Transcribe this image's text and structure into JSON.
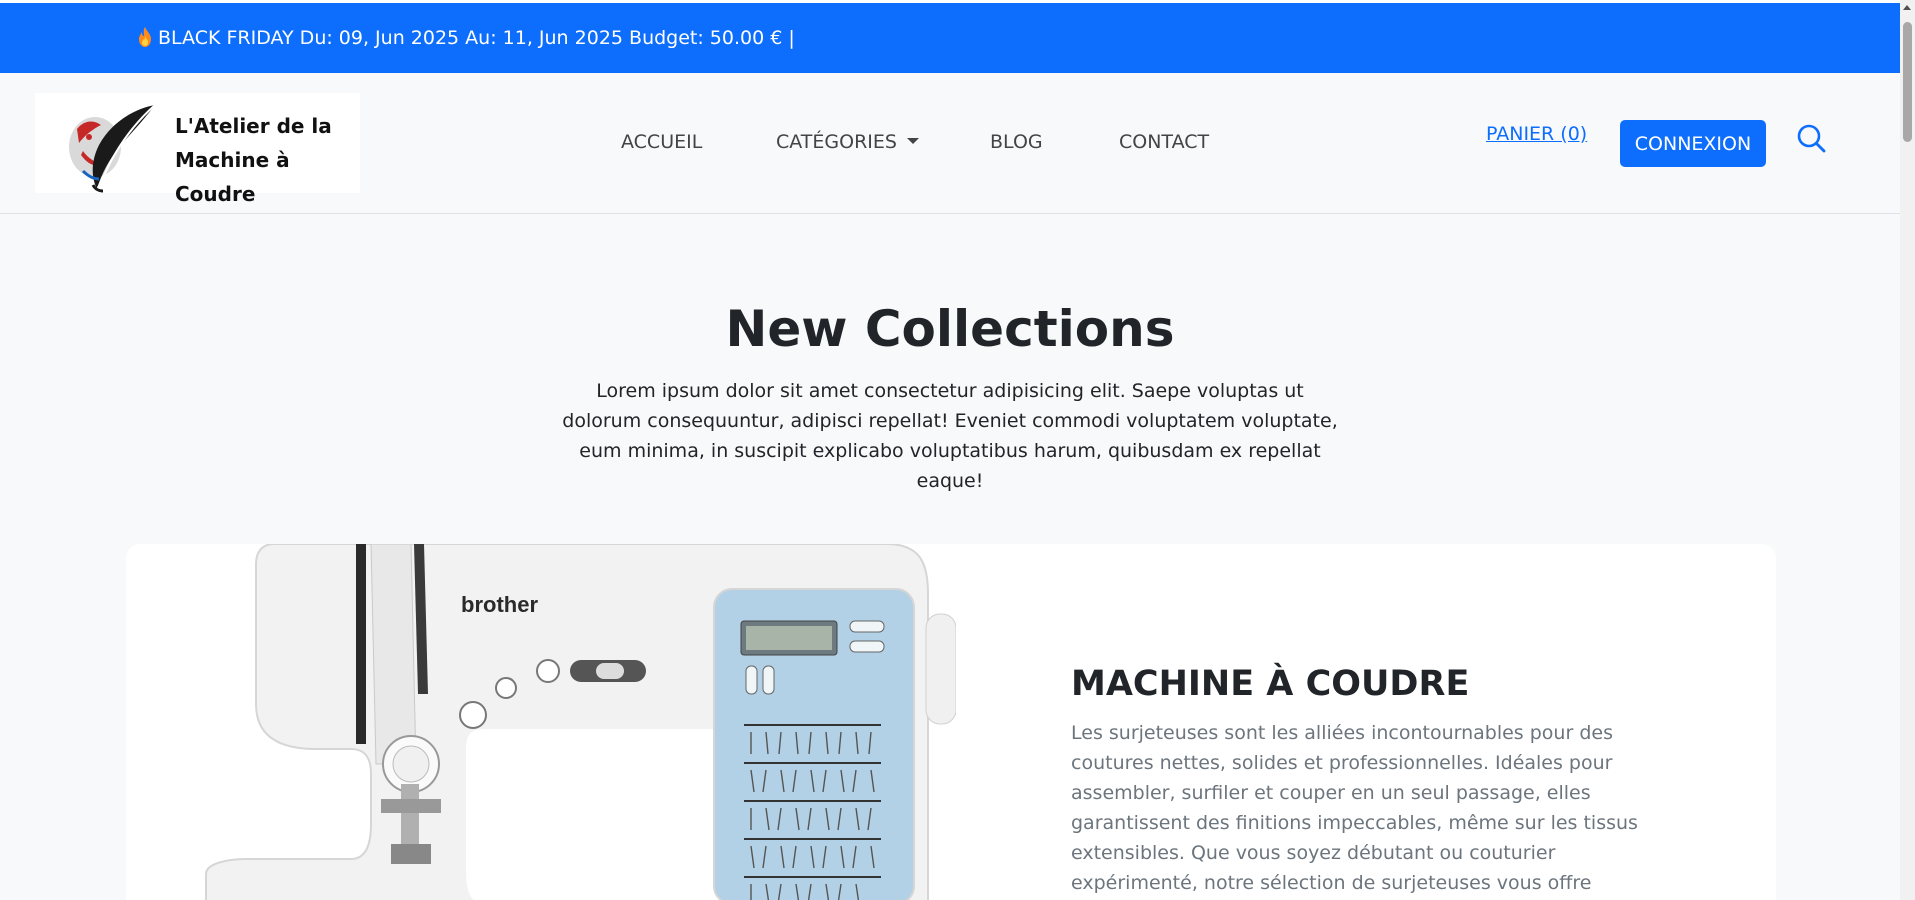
{
  "promo": {
    "text": "BLACK FRIDAY Du: 09, Jun 2025 Au: 11, Jun 2025 Budget: 50.00 € |",
    "icon": "fire-icon"
  },
  "brand": {
    "line1": "L'Atelier de la",
    "line2": "Machine à Coudre"
  },
  "nav": {
    "items": [
      "ACCUEIL",
      "CATÉGORIES",
      "BLOG",
      "CONTACT"
    ],
    "cart": "PANIER (0)",
    "login": "CONNEXION",
    "search_icon": "search-icon"
  },
  "hero": {
    "title": "New Collections",
    "description": "Lorem ipsum dolor sit amet consectetur adipisicing elit. Saepe voluptas ut dolorum consequuntur, adipisci repellat! Eveniet commodi voluptatem voluptate, eum minima, in suscipit explicabo voluptatibus harum, quibusdam ex repellat eaque!"
  },
  "feature": {
    "image_brand": "brother",
    "title": "MACHINE À COUDRE",
    "description": "Les surjeteuses sont les alliées incontournables pour des coutures nettes, solides et professionnelles. Idéales pour assembler, surfiler et couper en un seul passage, elles garantissent des finitions impeccables, même sur les tissus extensibles. Que vous soyez débutant ou couturier expérimenté, notre sélection de surjeteuses vous offre vitesse, précision et"
  },
  "colors": {
    "primary": "#0d6efd",
    "background": "#f8f9fa",
    "text": "#212529",
    "muted": "#6c757d"
  }
}
